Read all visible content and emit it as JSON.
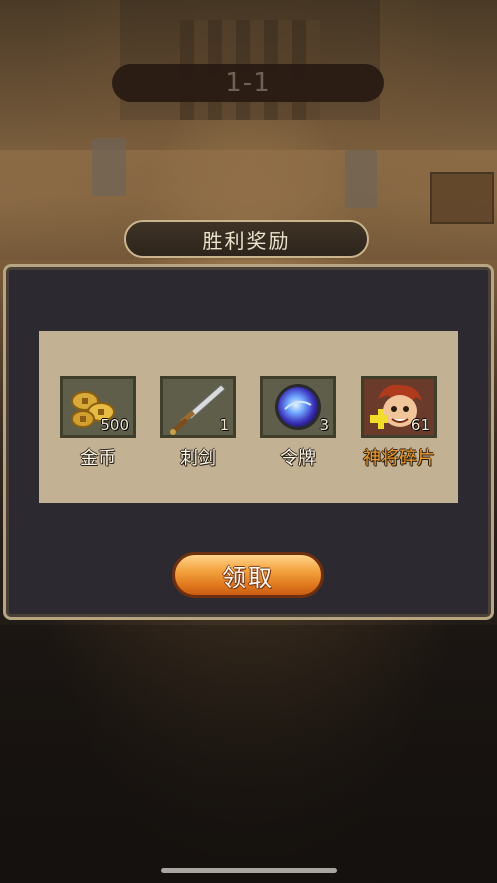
{
  "level": {
    "label": "1-1"
  },
  "reward_title": "胜利奖励",
  "items": [
    {
      "name": "金币",
      "quantity": "500",
      "icon": "gold-coins-icon",
      "name_color": "#fbf6ea"
    },
    {
      "name": "刺剑",
      "quantity": "1",
      "icon": "sword-icon",
      "name_color": "#fbf6ea"
    },
    {
      "name": "令牌",
      "quantity": "3",
      "icon": "token-orb-icon",
      "name_color": "#fbf6ea"
    },
    {
      "name": "神将碎片",
      "quantity": "61",
      "icon": "hero-fragment-icon",
      "name_color": "#ef9a2c"
    }
  ],
  "claim_button": {
    "label": "领取"
  },
  "colors": {
    "panel": "#2c2931",
    "items_area": "#c3b193",
    "button": "#f4a23f"
  }
}
